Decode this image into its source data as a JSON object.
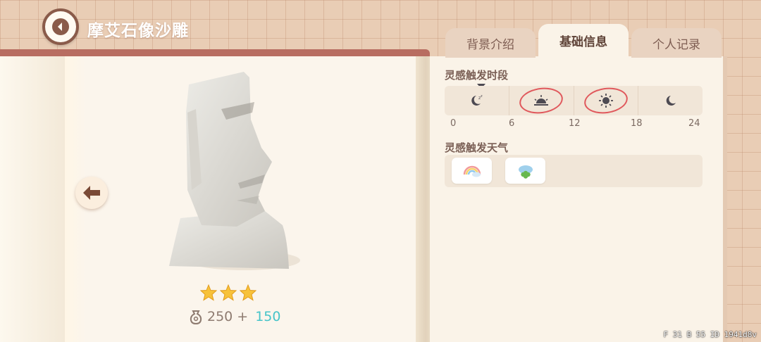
{
  "header": {
    "title": "摩艾石像沙雕"
  },
  "tabs": [
    {
      "label": "背景介绍",
      "active": false
    },
    {
      "label": "基础信息",
      "active": true
    },
    {
      "label": "个人记录",
      "active": false
    }
  ],
  "item": {
    "stars": 3,
    "price_base": "250",
    "price_plus": "+",
    "price_bonus": "150"
  },
  "inspiration_time": {
    "label": "灵感触发时段",
    "ticks": [
      "0",
      "6",
      "12",
      "18",
      "24"
    ],
    "segments": [
      {
        "icon": "moon-sleep-icon",
        "highlighted": false
      },
      {
        "icon": "sunrise-icon",
        "highlighted": true
      },
      {
        "icon": "sun-icon",
        "highlighted": true
      },
      {
        "icon": "moon-icon",
        "highlighted": false
      }
    ]
  },
  "inspiration_weather": {
    "label": "灵感触发天气",
    "items": [
      {
        "icon": "rainbow-icon"
      },
      {
        "icon": "clover-cloud-icon"
      }
    ]
  },
  "debug": {
    "text": "F 31  B 55  ID 1941d8v"
  },
  "colors": {
    "accent_bonus": "#46c4c9",
    "highlight_circle": "#e0585c",
    "tab_active": "#faf3e8"
  }
}
